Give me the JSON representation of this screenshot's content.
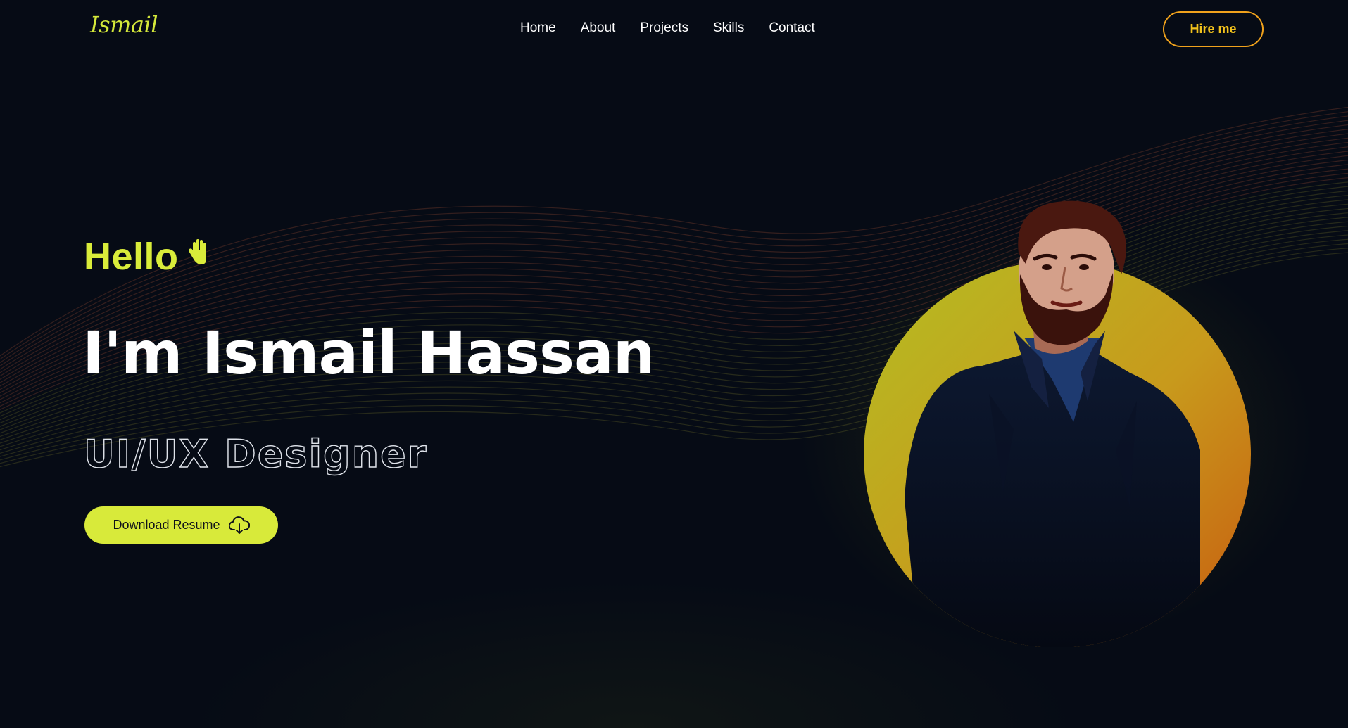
{
  "header": {
    "logo": "Ismail",
    "nav": [
      "Home",
      "About",
      "Projects",
      "Skills",
      "Contact"
    ],
    "hire_button": "Hire me"
  },
  "hero": {
    "greeting": "Hello",
    "greeting_icon": "waving-hand-icon",
    "name": "I'm Ismail Hassan",
    "role": "UI/UX Designer",
    "download_button": "Download Resume",
    "download_icon": "cloud-download-icon"
  },
  "colors": {
    "background": "#060b15",
    "accent_lime": "#d8ea3a",
    "accent_orange": "#f0a21c"
  }
}
